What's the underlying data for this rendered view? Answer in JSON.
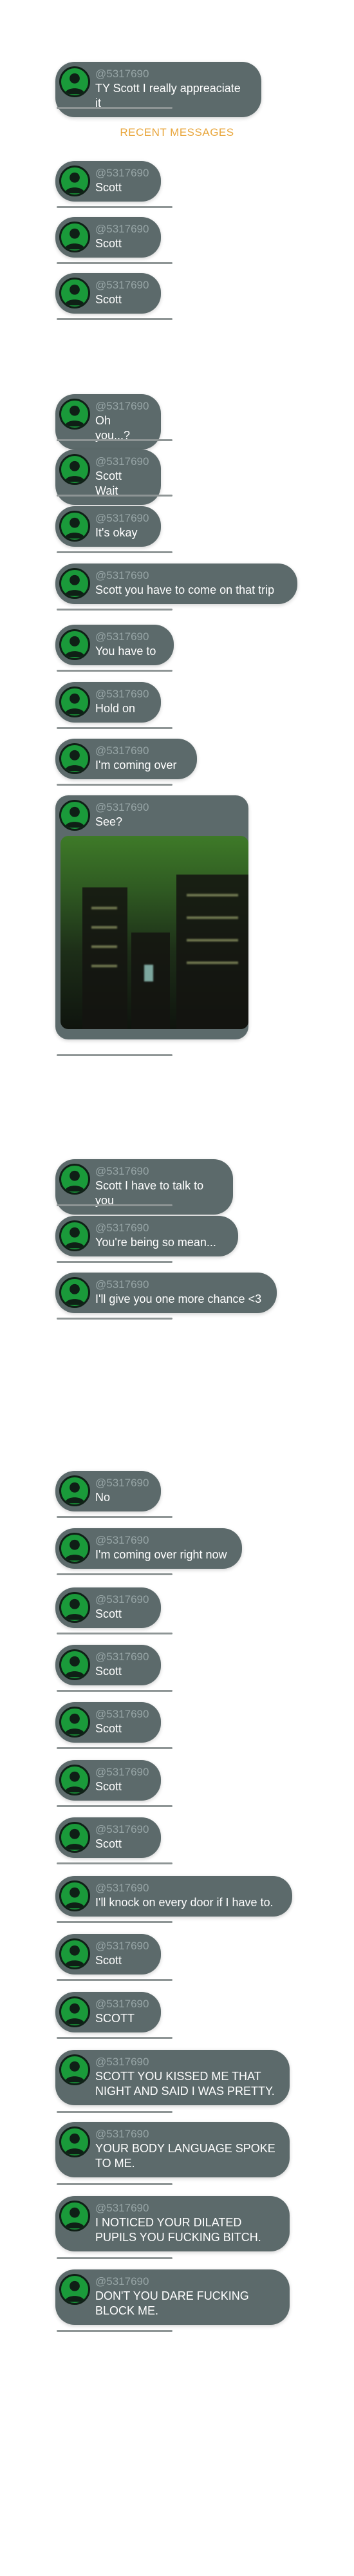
{
  "section_label": "RECENT MESSAGES",
  "colors": {
    "bubble": "#5c6a6b",
    "username": "#97a5a6",
    "accent": "#e8a53a",
    "avatar": "#1a9a3a"
  },
  "messages": [
    {
      "user": "@5317690",
      "text": "TY Scott I really appreaciate it"
    },
    {
      "user": "@5317690",
      "text": "Scott"
    },
    {
      "user": "@5317690",
      "text": "Scott"
    },
    {
      "user": "@5317690",
      "text": "Scott"
    },
    {
      "user": "@5317690",
      "text": "Oh you...?"
    },
    {
      "user": "@5317690",
      "text": "Scott Wait"
    },
    {
      "user": "@5317690",
      "text": "It's okay"
    },
    {
      "user": "@5317690",
      "text": "Scott you have to come on that trip"
    },
    {
      "user": "@5317690",
      "text": "You have to"
    },
    {
      "user": "@5317690",
      "text": "Hold on"
    },
    {
      "user": "@5317690",
      "text": "I'm coming over"
    },
    {
      "user": "@5317690",
      "text": "See?",
      "image": "blurry-night-building-photo"
    },
    {
      "user": "@5317690",
      "text": "Scott I have to talk to you"
    },
    {
      "user": "@5317690",
      "text": "You're being so mean..."
    },
    {
      "user": "@5317690",
      "text": "I'll give you one more chance <3"
    },
    {
      "user": "@5317690",
      "text": "No"
    },
    {
      "user": "@5317690",
      "text": "I'm coming over right now"
    },
    {
      "user": "@5317690",
      "text": "Scott"
    },
    {
      "user": "@5317690",
      "text": "Scott"
    },
    {
      "user": "@5317690",
      "text": "Scott"
    },
    {
      "user": "@5317690",
      "text": "Scott"
    },
    {
      "user": "@5317690",
      "text": "Scott"
    },
    {
      "user": "@5317690",
      "text": "I'll knock on every door if I have to."
    },
    {
      "user": "@5317690",
      "text": "Scott"
    },
    {
      "user": "@5317690",
      "text": "SCOTT"
    },
    {
      "user": "@5317690",
      "text": "SCOTT YOU KISSED ME THAT NIGHT AND SAID I WAS PRETTY."
    },
    {
      "user": "@5317690",
      "text": "YOUR BODY LANGUAGE SPOKE TO ME."
    },
    {
      "user": "@5317690",
      "text": "I NOTICED YOUR DILATED PUPILS YOU FUCKING BITCH."
    },
    {
      "user": "@5317690",
      "text": "DON'T YOU DARE FUCKING BLOCK ME."
    }
  ]
}
